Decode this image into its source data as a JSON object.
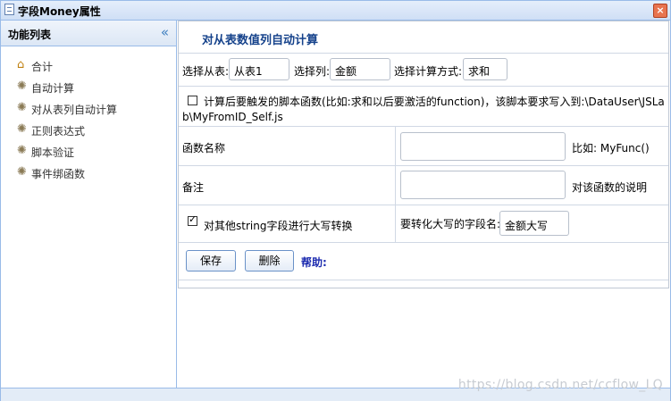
{
  "window": {
    "title": "字段Money属性",
    "close_icon": "close-icon"
  },
  "sidebar": {
    "title": "功能列表",
    "collapse_label": "«",
    "items": [
      {
        "label": "合计",
        "icon": "home-icon"
      },
      {
        "label": "自动计算",
        "icon": "gear-icon"
      },
      {
        "label": "对从表列自动计算",
        "icon": "gear-icon"
      },
      {
        "label": "正则表达式",
        "icon": "gear-icon"
      },
      {
        "label": "脚本验证",
        "icon": "gear-icon"
      },
      {
        "label": "事件绑函数",
        "icon": "gear-icon"
      }
    ]
  },
  "main": {
    "title": "对从表数值列自动计算",
    "select_dtl_label": "选择从表:",
    "select_dtl_value": "从表1",
    "select_col_label": "选择列:",
    "select_col_value": "金额",
    "calc_mode_label": "选择计算方式:",
    "calc_mode_value": "求和",
    "script_line1": "计算后要触发的脚本函数(比如:求和以后要激活的function)，该脚本要求写入到:\\DataUser\\JSLa",
    "script_line2": "b\\MyFromID_Self.js",
    "func_name_label": "函数名称",
    "func_name_value": "",
    "func_name_hint": "比如: MyFunc()",
    "remark_label": "备注",
    "remark_value": "",
    "remark_hint": "对该函数的说明",
    "upper_label": "对其他string字段进行大写转换",
    "upper_field_label": "要转化大写的字段名:",
    "upper_field_value": "金额大写",
    "save_label": "保存",
    "delete_label": "删除",
    "help_label": "帮助:"
  },
  "watermark": "https://blog.csdn.net/ccflow_LQ"
}
